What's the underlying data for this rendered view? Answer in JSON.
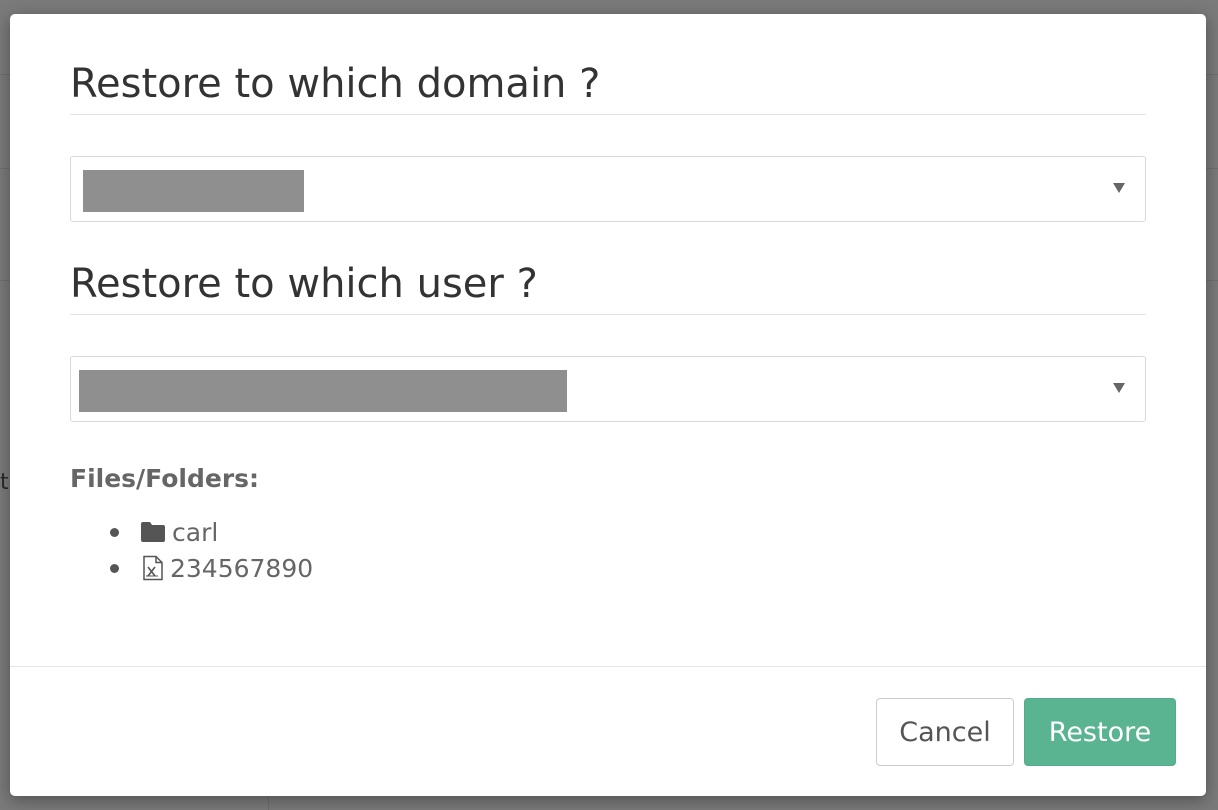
{
  "dialog": {
    "domain_title": "Restore to which domain ?",
    "user_title": "Restore to which user ?",
    "files_label": "Files/Folders:",
    "files": [
      {
        "icon": "folder-icon",
        "name": "carl"
      },
      {
        "icon": "excel-file-icon",
        "name": "234567890"
      }
    ],
    "cancel_label": "Cancel",
    "restore_label": "Restore"
  },
  "background": {
    "partial_text": "ti"
  },
  "colors": {
    "primary": "#5bb491",
    "text": "#333333",
    "muted_text": "#666666",
    "redaction": "#8f8f8f"
  }
}
